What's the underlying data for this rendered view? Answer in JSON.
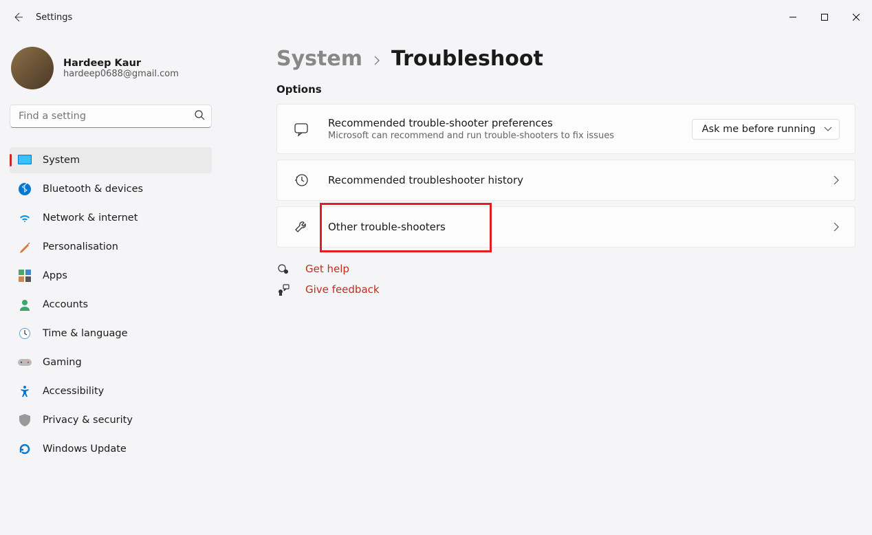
{
  "window": {
    "app_title": "Settings"
  },
  "profile": {
    "name": "Hardeep Kaur",
    "email": "hardeep0688@gmail.com"
  },
  "search": {
    "placeholder": "Find a setting"
  },
  "sidebar": {
    "items": [
      {
        "label": "System",
        "icon": "monitor",
        "active": true
      },
      {
        "label": "Bluetooth & devices",
        "icon": "bluetooth"
      },
      {
        "label": "Network & internet",
        "icon": "wifi"
      },
      {
        "label": "Personalisation",
        "icon": "paint"
      },
      {
        "label": "Apps",
        "icon": "apps"
      },
      {
        "label": "Accounts",
        "icon": "person"
      },
      {
        "label": "Time & language",
        "icon": "clock"
      },
      {
        "label": "Gaming",
        "icon": "gamepad"
      },
      {
        "label": "Accessibility",
        "icon": "accessibility"
      },
      {
        "label": "Privacy & security",
        "icon": "shield"
      },
      {
        "label": "Windows Update",
        "icon": "update"
      }
    ]
  },
  "breadcrumb": {
    "parent": "System",
    "current": "Troubleshoot"
  },
  "section_label": "Options",
  "cards": {
    "prefs": {
      "title": "Recommended trouble-shooter preferences",
      "subtitle": "Microsoft can recommend and run trouble-shooters to fix issues",
      "dropdown_value": "Ask me before running"
    },
    "history": {
      "title": "Recommended troubleshooter history"
    },
    "other": {
      "title": "Other trouble-shooters"
    }
  },
  "links": {
    "help": "Get help",
    "feedback": "Give feedback"
  }
}
